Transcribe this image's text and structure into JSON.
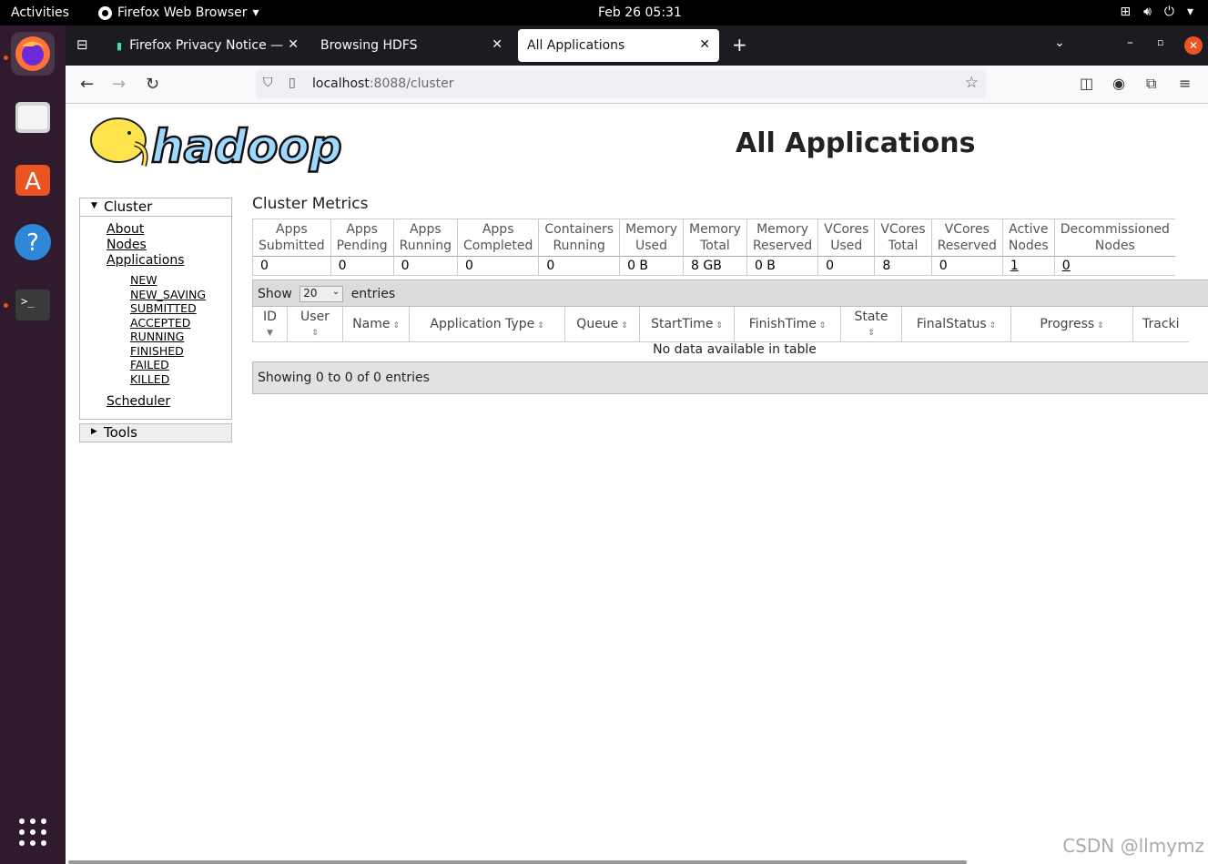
{
  "topbar": {
    "activities": "Activities",
    "app": "Firefox Web Browser",
    "clock": "Feb 26  05:31"
  },
  "tabs": [
    {
      "label": "Firefox Privacy Notice —",
      "active": false
    },
    {
      "label": "Browsing HDFS",
      "active": false
    },
    {
      "label": "All Applications",
      "active": true
    }
  ],
  "url": {
    "host": "localhost",
    "path": ":8088/cluster"
  },
  "page": {
    "title": "All Applications",
    "logo_text": "hadoop"
  },
  "sidebar": {
    "cluster_label": "Cluster",
    "links": [
      "About",
      "Nodes",
      "Applications"
    ],
    "app_states": [
      "NEW",
      "NEW_SAVING",
      "SUBMITTED",
      "ACCEPTED",
      "RUNNING",
      "FINISHED",
      "FAILED",
      "KILLED"
    ],
    "scheduler": "Scheduler",
    "tools_label": "Tools"
  },
  "metrics": {
    "title": "Cluster Metrics",
    "headers": [
      [
        "Apps",
        "Submitted"
      ],
      [
        "Apps",
        "Pending"
      ],
      [
        "Apps",
        "Running"
      ],
      [
        "Apps",
        "Completed"
      ],
      [
        "Containers",
        "Running"
      ],
      [
        "Memory",
        "Used"
      ],
      [
        "Memory",
        "Total"
      ],
      [
        "Memory",
        "Reserved"
      ],
      [
        "VCores",
        "Used"
      ],
      [
        "VCores",
        "Total"
      ],
      [
        "VCores",
        "Reserved"
      ],
      [
        "Active",
        "Nodes"
      ],
      [
        "Decommissioned",
        "Nodes"
      ]
    ],
    "values": [
      "0",
      "0",
      "0",
      "0",
      "0",
      "0 B",
      "8 GB",
      "0 B",
      "0",
      "8",
      "0",
      "1",
      "0"
    ]
  },
  "table": {
    "show": "Show",
    "entries_value": "20",
    "entries": "entries",
    "columns": [
      "ID",
      "User",
      "Name",
      "Application Type",
      "Queue",
      "StartTime",
      "FinishTime",
      "State",
      "FinalStatus",
      "Progress",
      "Tracki"
    ],
    "empty": "No data available in table",
    "footer": "Showing 0 to 0 of 0 entries"
  },
  "watermark": "CSDN @llmymz",
  "colors": {
    "accent": "#e95420",
    "tabbar": "#1c1b22",
    "dock": "#2f1a2e"
  }
}
